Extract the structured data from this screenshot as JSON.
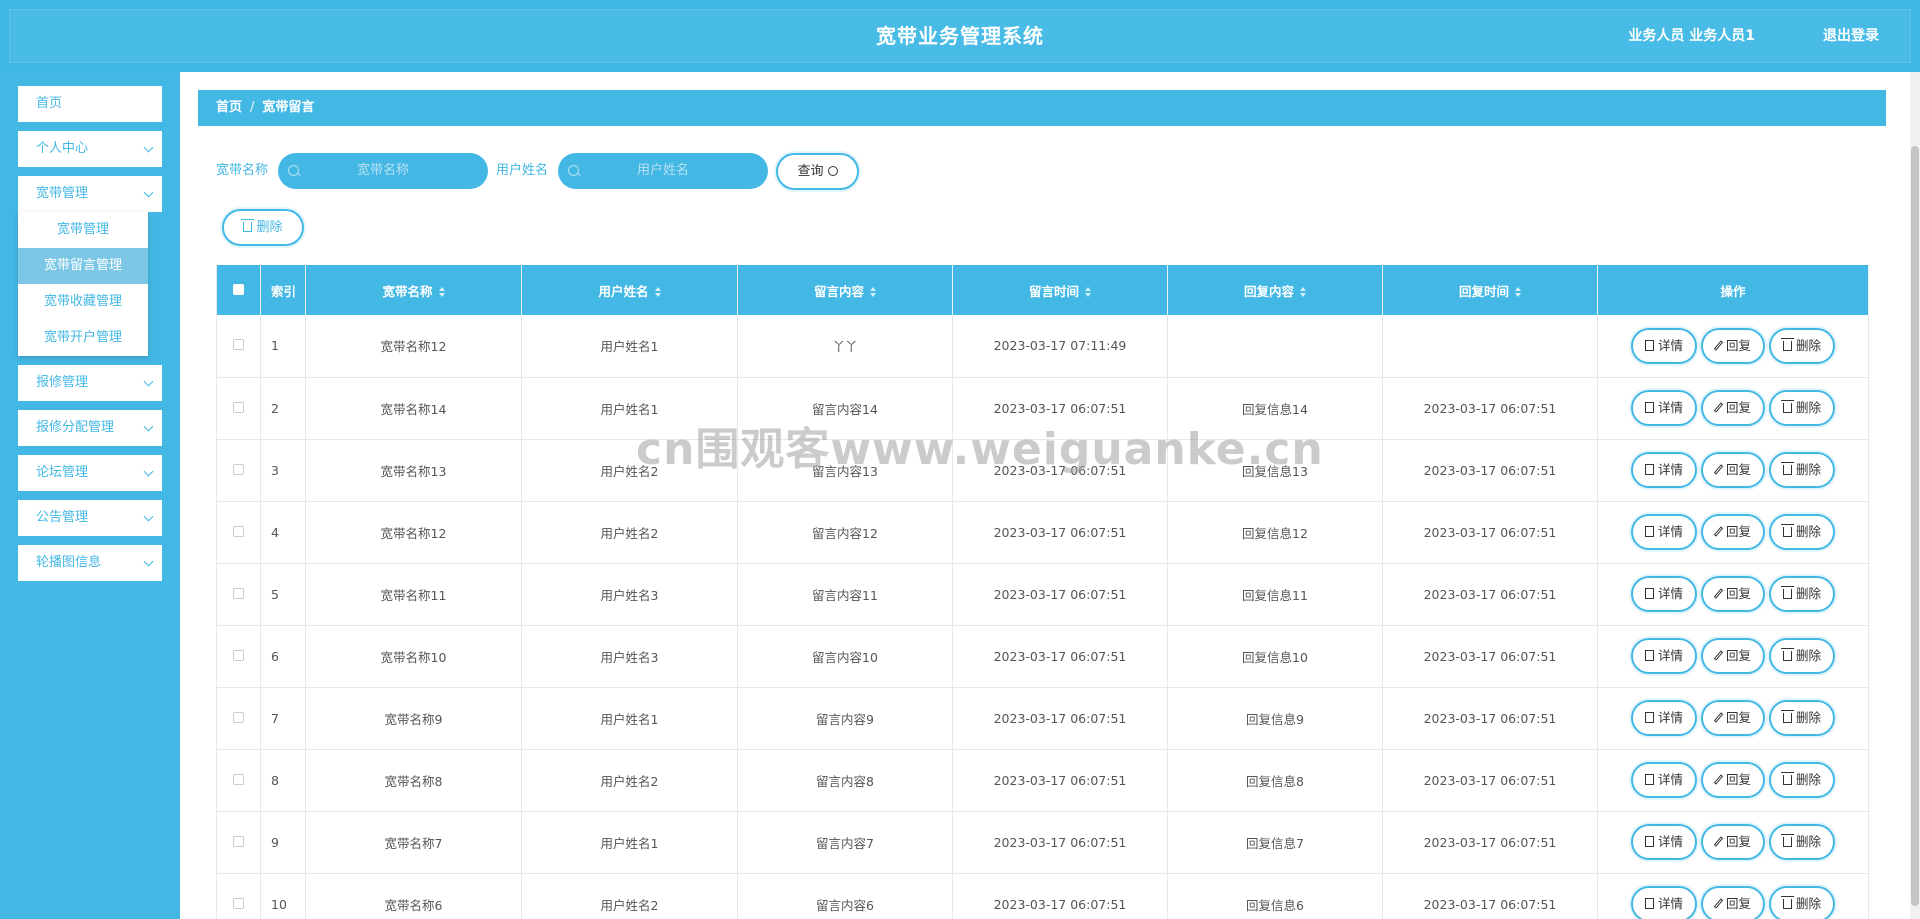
{
  "header": {
    "title": "宽带业务管理系统",
    "user": "业务人员 业务人员1",
    "logout": "退出登录"
  },
  "sidebar": {
    "items": [
      {
        "label": "首页"
      },
      {
        "label": "个人中心"
      },
      {
        "label": "宽带管理"
      },
      {
        "label": "报修管理"
      },
      {
        "label": "报修分配管理"
      },
      {
        "label": "论坛管理"
      },
      {
        "label": "公告管理"
      },
      {
        "label": "轮播图信息"
      }
    ],
    "submenu": [
      {
        "label": "宽带管理"
      },
      {
        "label": "宽带留言管理"
      },
      {
        "label": "宽带收藏管理"
      },
      {
        "label": "宽带开户管理"
      }
    ]
  },
  "breadcrumb": {
    "home": "首页",
    "sep": "/",
    "current": "宽带留言"
  },
  "filters": {
    "broadband_label": "宽带名称",
    "broadband_placeholder": "宽带名称",
    "user_label": "用户姓名",
    "user_placeholder": "用户姓名",
    "query_label": "查询",
    "delete_label": "删除"
  },
  "table": {
    "headers": [
      "索引",
      "宽带名称",
      "用户姓名",
      "留言内容",
      "留言时间",
      "回复内容",
      "回复时间",
      "操作"
    ],
    "actions": {
      "detail": "详情",
      "reply": "回复",
      "delete": "删除"
    },
    "rows": [
      [
        "1",
        "宽带名称12",
        "用户姓名1",
        "丫丫",
        "2023-03-17 07:11:49",
        "",
        ""
      ],
      [
        "2",
        "宽带名称14",
        "用户姓名1",
        "留言内容14",
        "2023-03-17 06:07:51",
        "回复信息14",
        "2023-03-17 06:07:51"
      ],
      [
        "3",
        "宽带名称13",
        "用户姓名2",
        "留言内容13",
        "2023-03-17 06:07:51",
        "回复信息13",
        "2023-03-17 06:07:51"
      ],
      [
        "4",
        "宽带名称12",
        "用户姓名2",
        "留言内容12",
        "2023-03-17 06:07:51",
        "回复信息12",
        "2023-03-17 06:07:51"
      ],
      [
        "5",
        "宽带名称11",
        "用户姓名3",
        "留言内容11",
        "2023-03-17 06:07:51",
        "回复信息11",
        "2023-03-17 06:07:51"
      ],
      [
        "6",
        "宽带名称10",
        "用户姓名3",
        "留言内容10",
        "2023-03-17 06:07:51",
        "回复信息10",
        "2023-03-17 06:07:51"
      ],
      [
        "7",
        "宽带名称9",
        "用户姓名1",
        "留言内容9",
        "2023-03-17 06:07:51",
        "回复信息9",
        "2023-03-17 06:07:51"
      ],
      [
        "8",
        "宽带名称8",
        "用户姓名2",
        "留言内容8",
        "2023-03-17 06:07:51",
        "回复信息8",
        "2023-03-17 06:07:51"
      ],
      [
        "9",
        "宽带名称7",
        "用户姓名1",
        "留言内容7",
        "2023-03-17 06:07:51",
        "回复信息7",
        "2023-03-17 06:07:51"
      ],
      [
        "10",
        "宽带名称6",
        "用户姓名2",
        "留言内容6",
        "2023-03-17 06:07:51",
        "回复信息6",
        "2023-03-17 06:07:51"
      ]
    ]
  },
  "watermark": "cn围观客www.weiguanke.cn",
  "colors": {
    "accent": "#44b8e5",
    "header": "#3fb6e3",
    "submenu_active": "#7cc7e6"
  }
}
